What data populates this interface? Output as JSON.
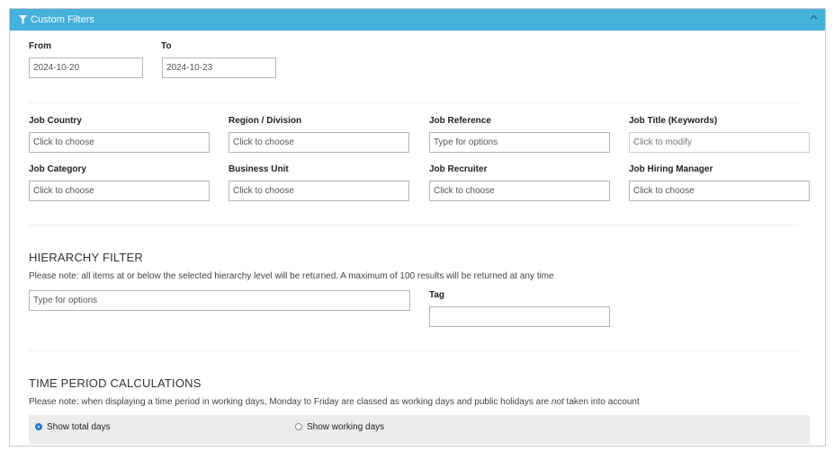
{
  "header": {
    "title": "Custom Filters",
    "filter_icon": "funnel-icon",
    "collapse_icon": "chevron-up-icon",
    "color": "#45b1dd"
  },
  "date_range": {
    "from_label": "From",
    "from_value": "2024-10-20",
    "to_label": "To",
    "to_value": "2024-10-23"
  },
  "filters": {
    "job_country": {
      "label": "Job Country",
      "placeholder": "Click to choose"
    },
    "region_division": {
      "label": "Region / Division",
      "placeholder": "Click to choose"
    },
    "job_reference": {
      "label": "Job Reference",
      "placeholder": "Type for options"
    },
    "job_title": {
      "label": "Job Title (Keywords)",
      "placeholder": "Click to modify"
    },
    "job_category": {
      "label": "Job Category",
      "placeholder": "Click to choose"
    },
    "business_unit": {
      "label": "Business Unit",
      "placeholder": "Click to choose"
    },
    "job_recruiter": {
      "label": "Job Recruiter",
      "placeholder": "Click to choose"
    },
    "job_hiring_manager": {
      "label": "Job Hiring Manager",
      "placeholder": "Click to choose"
    }
  },
  "hierarchy": {
    "title": "HIERARCHY FILTER",
    "note": "Please note: all items at or below the selected hierarchy level will be returned. A maximum of 100 results will be returned at any time",
    "placeholder": "Type for options",
    "tag_label": "Tag",
    "tag_value": ""
  },
  "time_period": {
    "title": "TIME PERIOD CALCULATIONS",
    "note_before": "Please note: when displaying a time period in working days, Monday to Friday are classed as working days and public holidays are ",
    "note_emphasis": "not",
    "note_after": " taken into account",
    "option_total": "Show total days",
    "option_working": "Show working days",
    "selected": "Show total days"
  }
}
